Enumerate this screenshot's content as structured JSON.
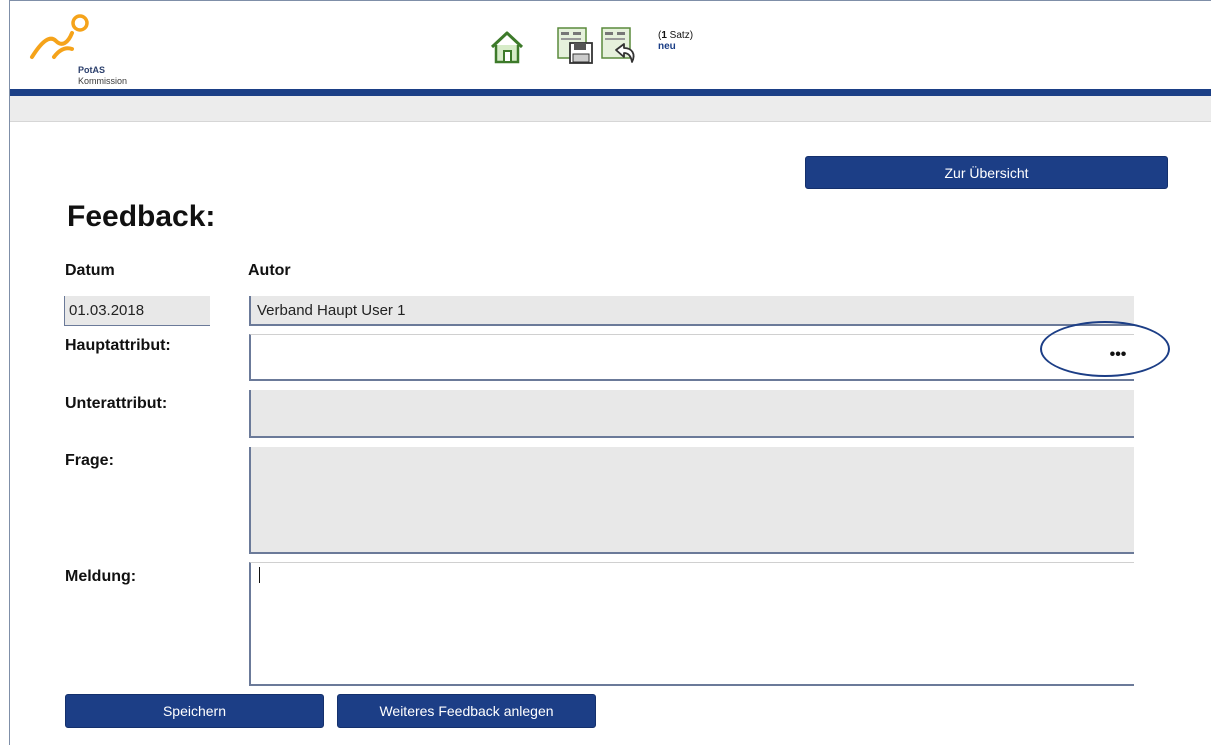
{
  "logo": {
    "line1": "PotAS",
    "line2": "Kommission"
  },
  "toolbar": {
    "home_icon": "home-icon",
    "save_icon": "save-record-icon",
    "undo_icon": "undo-record-icon",
    "record_count_prefix": "(",
    "record_count_number": "1",
    "record_count_suffix": " Satz)",
    "record_status": "neu"
  },
  "nav": {
    "overview_label": "Zur Übersicht"
  },
  "form": {
    "title": "Feedback:",
    "datum_label": "Datum",
    "datum_value": "01.03.2018",
    "autor_label": "Autor",
    "autor_value": "Verband Haupt User 1",
    "hauptattribut_label": "Hauptattribut:",
    "hauptattribut_value": "",
    "more_label": "•••",
    "unterattribut_label": "Unterattribut:",
    "unterattribut_value": "",
    "frage_label": "Frage:",
    "frage_value": "",
    "meldung_label": "Meldung:",
    "meldung_value": ""
  },
  "actions": {
    "save_label": "Speichern",
    "add_feedback_label": "Weiteres Feedback anlegen"
  },
  "colors": {
    "brand_blue": "#1c3e86",
    "logo_orange": "#f5a31a",
    "field_gray": "#e8e8e8",
    "home_green": "#5a9e3a"
  }
}
